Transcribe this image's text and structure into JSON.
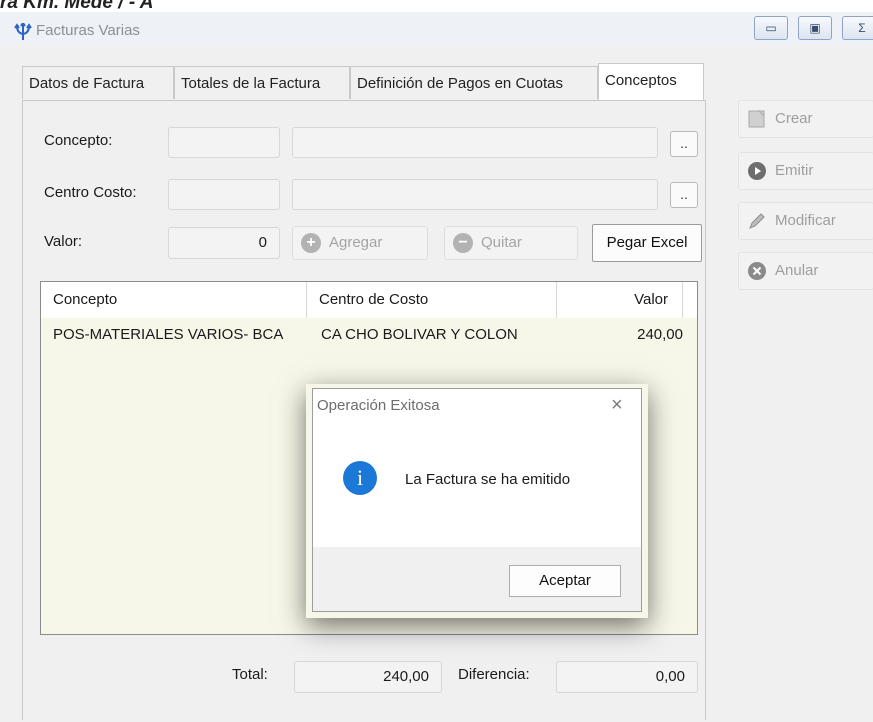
{
  "cut_top_text": "ra Km. Mede / - A",
  "window": {
    "title": "Facturas Varias",
    "controls": {
      "minimize": "▭",
      "maximize": "▣",
      "close": "Σ"
    }
  },
  "tabs": [
    {
      "label": "Datos de Factura"
    },
    {
      "label": "Totales de la Factura"
    },
    {
      "label": "Definición de Pagos en Cuotas"
    },
    {
      "label": "Conceptos",
      "active": true
    }
  ],
  "form": {
    "concepto_label": "Concepto:",
    "centro_costo_label": "Centro Costo:",
    "valor_label": "Valor:",
    "valor_value": "0",
    "dots": "..",
    "agregar_label": "Agregar",
    "quitar_label": "Quitar",
    "pegar_excel_label": "Pegar Excel"
  },
  "grid": {
    "columns": [
      "Concepto",
      "Centro de Costo",
      "Valor"
    ],
    "rows": [
      {
        "concepto": "POS-MATERIALES VARIOS- BCA",
        "centro": "CA CHO BOLIVAR Y COLON",
        "valor": "240,00"
      }
    ]
  },
  "totals": {
    "total_label": "Total:",
    "total_value": "240,00",
    "diferencia_label": "Diferencia:",
    "diferencia_value": "0,00"
  },
  "sidebar": {
    "crear": "Crear",
    "emitir": "Emitir",
    "modificar": "Modificar",
    "anular": "Anular"
  },
  "dialog": {
    "title": "Operación Exitosa",
    "close": "×",
    "icon": "i",
    "message": "La Factura se ha emitido",
    "ok_label": "Aceptar"
  },
  "colors": {
    "grid_bg": "#f7f7e9",
    "info_icon": "#1c78d6",
    "disabled_text": "#a4a4a4"
  }
}
